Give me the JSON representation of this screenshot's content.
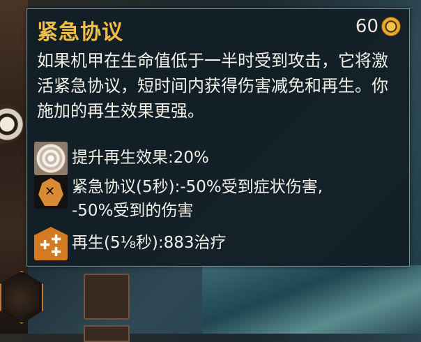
{
  "tooltip": {
    "title": "紧急协议",
    "cost": "60",
    "description": "如果机甲在生命值低于一半时受到攻击，它将激活紧急协议，短时间内获得伤害减免和再生。你施加的再生效果更强。",
    "effects": [
      {
        "icon": "target-icon",
        "text": "提升再生效果:20%"
      },
      {
        "icon": "protocol-icon",
        "text_line1": "紧急协议(5秒):-50%受到症状伤害,",
        "text_line2": "-50%受到的伤害"
      },
      {
        "icon": "regen-icon",
        "text": "再生(5⅛秒):883治疗"
      }
    ]
  },
  "colors": {
    "title": "#f1bd45",
    "text": "#f2efe9",
    "panel_bg": "#121e26",
    "border": "#7a8d96"
  }
}
